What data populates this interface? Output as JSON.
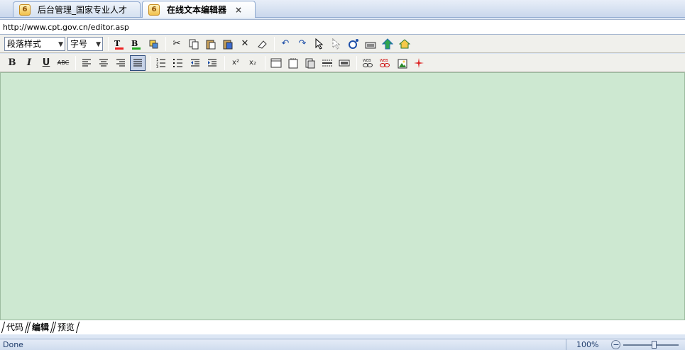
{
  "tabs": [
    {
      "icon": "ie-tab-icon",
      "icon_glyph": "6",
      "label": "后台管理_国家专业人才",
      "active": false
    },
    {
      "icon": "ie-tab-icon",
      "icon_glyph": "6",
      "label": "在线文本编辑器",
      "active": true,
      "close": "×"
    }
  ],
  "address": {
    "url": "http://www.cpt.gov.cn/editor.asp"
  },
  "toolbar1": {
    "paragraph_style": "段落样式",
    "font_size": "字号",
    "icons": [
      "text-color-icon",
      "background-color-icon",
      "highlight-icon",
      "cut-icon",
      "copy-icon",
      "paste-icon",
      "paste-word-icon",
      "delete-icon",
      "eraser-icon",
      "undo-icon",
      "redo-icon",
      "select-icon",
      "select-all-icon",
      "find-icon",
      "keyboard-icon",
      "upload-icon",
      "home-icon"
    ]
  },
  "toolbar2": {
    "bold": "B",
    "italic": "I",
    "underline": "U",
    "strikethrough": "ABC",
    "superscript": "x²",
    "subscript": "x₂",
    "icons": [
      "align-left-icon",
      "align-center-icon",
      "align-right-icon",
      "justify-icon",
      "ordered-list-icon",
      "unordered-list-icon",
      "outdent-icon",
      "indent-icon",
      "table-icon",
      "new-page-icon",
      "page-copy-icon",
      "horizontal-rule-icon",
      "media-icon",
      "link-icon",
      "unlink-icon",
      "image-icon",
      "flash-icon"
    ]
  },
  "modes": [
    "代码",
    "编辑",
    "预览"
  ],
  "active_mode": "编辑",
  "status": {
    "text": "Done",
    "zoom": "100%",
    "zoom_level": 0.55
  },
  "colors": {
    "editor_bg": "#cde8d1",
    "toolbar_bg": "#f0f0ec"
  }
}
